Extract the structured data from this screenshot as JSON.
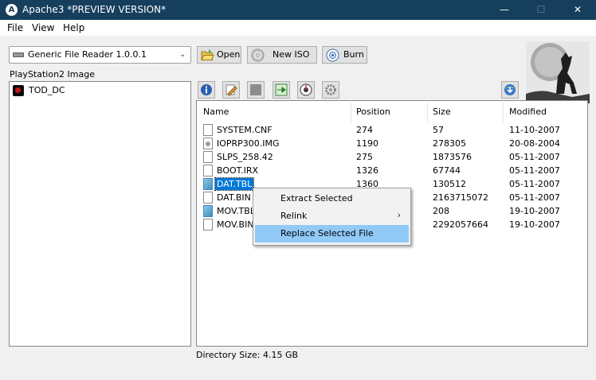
{
  "window": {
    "title": "Apache3  *PREVIEW VERSION*",
    "controls": {
      "minimize": "—",
      "maximize": "☐",
      "close": "✕"
    }
  },
  "menu": {
    "file": "File",
    "view": "View",
    "help": "Help"
  },
  "toolbar": {
    "reader": "Generic File Reader 1.0.0.1",
    "open_label": "Open",
    "newiso_label": "New ISO",
    "burn_label": "Burn"
  },
  "left_panel": {
    "label": "PlayStation2 Image",
    "tree": [
      {
        "label": "TOD_DC",
        "icon": "ps2-icon"
      }
    ]
  },
  "file_list": {
    "columns": [
      "Name",
      "Position",
      "Size",
      "Modified"
    ],
    "rows": [
      {
        "name": "SYSTEM.CNF",
        "position": "274",
        "size": "57",
        "modified": "11-10-2007",
        "icon": "file"
      },
      {
        "name": "IOPRP300.IMG",
        "position": "1190",
        "size": "278305",
        "modified": "20-08-2004",
        "icon": "disc"
      },
      {
        "name": "SLPS_258.42",
        "position": "275",
        "size": "1873576",
        "modified": "05-11-2007",
        "icon": "file"
      },
      {
        "name": "BOOT.IRX",
        "position": "1326",
        "size": "67744",
        "modified": "05-11-2007",
        "icon": "file"
      },
      {
        "name": "DAT.TBL",
        "position": "1360",
        "size": "130512",
        "modified": "05-11-2007",
        "icon": "tbl",
        "selected": true
      },
      {
        "name": "DAT.BIN",
        "position": "",
        "size": "2163715072",
        "modified": "05-11-2007",
        "icon": "file"
      },
      {
        "name": "MOV.TBL",
        "position": "",
        "size": "208",
        "modified": "19-10-2007",
        "icon": "tbl"
      },
      {
        "name": "MOV.BIN",
        "position": "",
        "size": "2292057664",
        "modified": "19-10-2007",
        "icon": "file"
      }
    ]
  },
  "context_menu": {
    "items": [
      {
        "label": "Extract Selected"
      },
      {
        "label": "Relink",
        "submenu_arrow": "›"
      },
      {
        "label": "Replace Selected File",
        "hovered": true
      }
    ]
  },
  "status": {
    "directory_size": "Directory Size: 4.15 GB"
  },
  "colors": {
    "titlebar": "#153f5c",
    "selection": "#0078d7",
    "menu_hover": "#91c9f7"
  }
}
